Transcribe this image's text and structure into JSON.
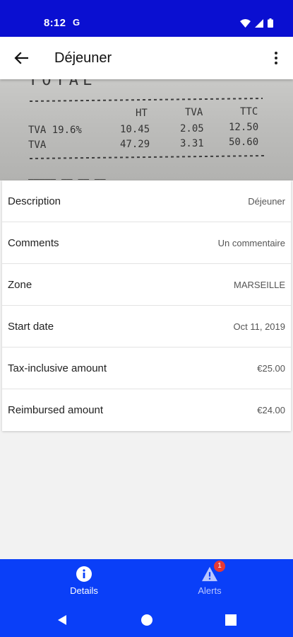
{
  "status_bar": {
    "time": "8:12",
    "app_icon_glyph": "G"
  },
  "app_bar": {
    "title": "Déjeuner"
  },
  "receipt": {
    "header_ht": "HT",
    "header_tva": "TVA",
    "header_ttc": "TTC",
    "rows": [
      {
        "label": "TVA 19.6%",
        "ht": "10.45",
        "tva": "2.05",
        "ttc": "12.50"
      },
      {
        "label": "TVA",
        "ht": "47.29",
        "tva": "3.31",
        "ttc": "50.60"
      }
    ]
  },
  "details": [
    {
      "label": "Description",
      "value": "Déjeuner"
    },
    {
      "label": "Comments",
      "value": "Un commentaire"
    },
    {
      "label": "Zone",
      "value": "MARSEILLE"
    },
    {
      "label": "Start date",
      "value": "Oct 11, 2019"
    },
    {
      "label": "Tax-inclusive amount",
      "value": "€25.00"
    },
    {
      "label": "Reimbursed amount",
      "value": "€24.00"
    }
  ],
  "bottom_nav": {
    "details_label": "Details",
    "alerts_label": "Alerts",
    "alerts_badge": "1",
    "active": "details"
  },
  "colors": {
    "status_bar": "#0a0fd1",
    "bottom_nav": "#0a3ff8",
    "badge": "#e53935"
  },
  "icons": {
    "back": "arrow-left-icon",
    "more": "more-vert-icon",
    "details": "info-icon",
    "alerts": "warning-icon"
  }
}
